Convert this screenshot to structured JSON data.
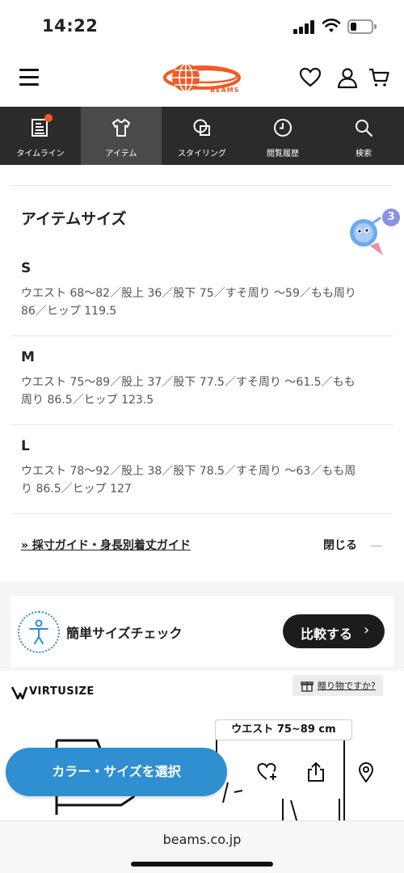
{
  "status": {
    "time": "14:22"
  },
  "brand": {
    "name": "BEAMS",
    "accent": "#f15a24"
  },
  "header": {
    "menu_icon": "hamburger-icon",
    "icons": [
      "heart-icon",
      "user-icon",
      "cart-icon"
    ]
  },
  "nav": {
    "items": [
      {
        "label": "タイムライン",
        "icon": "timeline-icon"
      },
      {
        "label": "アイテム",
        "icon": "shirt-icon"
      },
      {
        "label": "スタイリング",
        "icon": "styling-icon"
      },
      {
        "label": "閲覧履歴",
        "icon": "clock-icon"
      },
      {
        "label": "検索",
        "icon": "search-icon"
      }
    ],
    "active": "アイテム"
  },
  "size_section": {
    "title": "アイテムサイズ",
    "notification_count": "3",
    "sizes": [
      {
        "label": "S",
        "line1": "ウエスト 68〜82／股上 36／股下 75／すそ周り 〜59／もも周り",
        "line2": "86／ヒップ 119.5"
      },
      {
        "label": "M",
        "line1": "ウエスト 75〜89／股上 37／股下 77.5／すそ周り 〜61.5／もも",
        "line2": "周り 86.5／ヒップ 123.5"
      },
      {
        "label": "L",
        "line1": "ウエスト 78〜92／股上 38／股下 78.5／すそ周り 〜63／もも周",
        "line2": "り 86.5／ヒップ 127"
      }
    ],
    "guide_link": "» 採寸ガイド・身長別着丈ガイド",
    "close_label": "閉じる"
  },
  "size_check": {
    "label": "簡単サイズチェック",
    "compare_button": "比較する",
    "compare_arrow": "›"
  },
  "virtusize": {
    "brand": "VIRTUSIZE",
    "gift_text": "贈り物ですか?"
  },
  "illustration": {
    "waist_tag": "ウエスト 75~89 cm"
  },
  "actions": {
    "select_button": "カラー・サイズを選択",
    "icons": [
      "heart-plus-icon",
      "share-icon",
      "location-pin-icon"
    ]
  },
  "browser": {
    "url": "beams.co.jp"
  },
  "colors": {
    "nav_bg": "#2b2b2b",
    "nav_active": "#4a4a4a",
    "select_btn": "#2f8fd0",
    "compare_btn": "#1c1c1c"
  }
}
